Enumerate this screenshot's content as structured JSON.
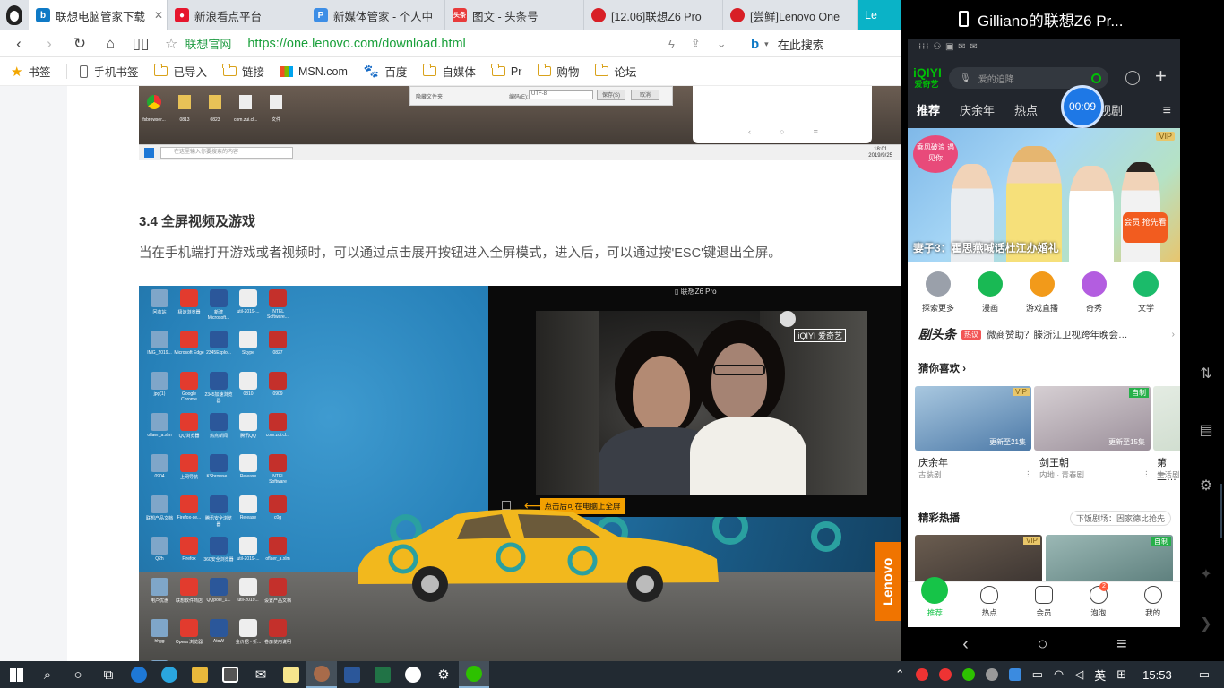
{
  "browser": {
    "tabs": [
      {
        "label": "联想电脑管家下载",
        "icon": "bing-icon",
        "color": "#0f7ac6"
      },
      {
        "label": "新浪看点平台",
        "icon": "weibo-icon",
        "color": "#e6162d"
      },
      {
        "label": "新媒体管家 - 个人中",
        "icon": "p-icon",
        "color": "#3d8ee6"
      },
      {
        "label": "图文 - 头条号",
        "icon": "toutiao-icon",
        "color": "#e83a3a"
      },
      {
        "label": "[12.06]联想Z6 Pro",
        "icon": "lenovo-icon",
        "color": "#d81f26"
      },
      {
        "label": "[尝鲜]Lenovo One",
        "icon": "lenovo-icon",
        "color": "#d81f26"
      },
      {
        "label": "Le",
        "icon": "lenovo-icon",
        "color": "#0ab3c7"
      }
    ],
    "site_label": "联想官网",
    "url": "https://one.lenovo.com/download.html",
    "search_label": "在此搜索",
    "bookmarks": [
      "书签",
      "手机书签",
      "已导入",
      "链接",
      "MSN.com",
      "百度",
      "自媒体",
      "Pr",
      "购物",
      "论坛"
    ]
  },
  "article": {
    "section_title": "3.4 全屏视频及游戏",
    "section_text": "当在手机端打开游戏或者视频时，可以通过点击展开按钮进入全屏模式，进入后，可以通过按'ESC'键退出全屏。",
    "shot1": {
      "search_placeholder": "在这里输入你要搜索的内容",
      "time": "18:01",
      "date": "2019/9/25",
      "dialog_label": "隐藏文件夹",
      "encoding_label": "编码(E):",
      "encoding_value": "UTF-8",
      "save_button": "保存(S)",
      "cancel_button": "取消",
      "desktop_labels": [
        "fsbrowser...",
        "0813",
        "0823",
        "com.zui.cl...",
        "文件"
      ]
    },
    "shot2": {
      "mirror_title": "联想Z6 Pro",
      "video_logo": "iQIYI 爱奇艺",
      "fullscreen_hint": "点击后可在电脑上全屏",
      "lenovo_tag": "Lenovo",
      "desktop_labels": [
        "回收站",
        "极速浏览器",
        "新建 Microsoft...",
        "util-2019-...",
        "INTEL Software...",
        "IMG_2019...",
        "Microsoft Edge",
        "2345Explo...",
        "Skype",
        "0827",
        "jpg(1)",
        "Google Chrome",
        "2345加速浏览器",
        "0810",
        "0909",
        "oflaer_a.xlm",
        "QQ浏览器",
        "热点新闻",
        "腾讯QQ",
        "com.zui.cl...",
        "0904",
        "上网导航",
        "KSbrowse...",
        "Release",
        "INTEL Software",
        "联想产品文档",
        "Firefox-se...",
        "腾讯安全浏览器",
        "Release",
        "c0g",
        "Q2h",
        "Firefox",
        "360安全浏览器",
        "util-2019-...",
        "oflaer_a.xlm",
        "用户优惠",
        "联想软件商店",
        "QQpole_1...",
        "util-2019...",
        "设置产品文档",
        "hhgg",
        "Opera 浏览器",
        "AtoW",
        "金价据 - 折...",
        "卷册使用说明",
        "0923"
      ]
    }
  },
  "phone": {
    "window_title": "Gilliano的联想Z6 Pr...",
    "status_text": "⁝⁝⁝ ⚇ ▣ ✉ ✉",
    "app_logo_top": "iQIYI",
    "app_logo_bottom": "爱奇艺",
    "search_placeholder": "爱的迫降",
    "timer": "00:09",
    "tabs": [
      "推荐",
      "庆余年",
      "热点",
      "电视剧"
    ],
    "banner": {
      "vip": "VIP",
      "badge": "乘风破浪 遇见你",
      "caption": "妻子3：霍思燕喊话杜江办婚礼",
      "gift": "会员 抢先看"
    },
    "channels": [
      {
        "label": "探索更多",
        "color": "#9aa0aa"
      },
      {
        "label": "漫画",
        "color": "#19b954"
      },
      {
        "label": "游戏直播",
        "color": "#f29a1a"
      },
      {
        "label": "奇秀",
        "color": "#b35de0"
      },
      {
        "label": "文学",
        "color": "#1bbb6a"
      }
    ],
    "headline": {
      "logo": "剧头条",
      "tag": "热议",
      "text": "微商赞助？滕浙江卫视跨年晚会…"
    },
    "guess_title": "猜你喜欢 ›",
    "guess_cards": [
      {
        "name": "庆余年",
        "sub": "古装剧",
        "badge": "VIP",
        "ep": "更新至21集",
        "color": "#4d7aa8"
      },
      {
        "name": "剑王朝",
        "sub": "内地 · 青春剧",
        "badge": "自制",
        "ep": "更新至15集",
        "color": "#9b8f9a"
      },
      {
        "name": "第二…",
        "sub": "生活剧",
        "badge": "",
        "ep": "",
        "color": "#c9d8c8"
      }
    ],
    "hot_title": "精彩热播",
    "hot_link": "下饭剧场：固家德比抢先",
    "hot_cards": [
      {
        "badge": "VIP",
        "color": "#3a3330"
      },
      {
        "badge": "自制",
        "color": "#5a7c7a"
      }
    ],
    "bottom_nav": [
      {
        "label": "推荐",
        "active": true
      },
      {
        "label": "热点",
        "active": false
      },
      {
        "label": "会员",
        "active": false
      },
      {
        "label": "泡泡",
        "active": false,
        "badge": "2"
      },
      {
        "label": "我的",
        "active": false
      }
    ]
  },
  "taskbar": {
    "ime": "英",
    "time": "15:53"
  }
}
